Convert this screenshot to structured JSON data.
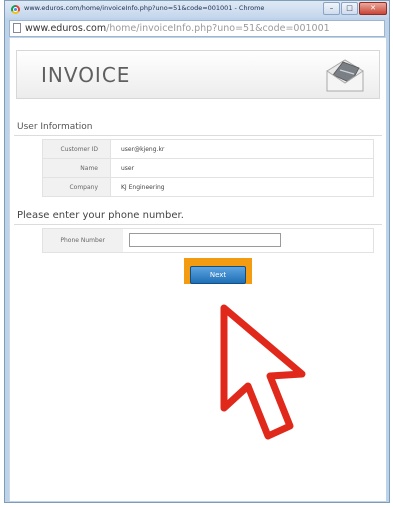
{
  "window": {
    "title": "www.eduros.com/home/invoiceInfo.php?uno=51&code=001001 - Chrome",
    "controls": [
      "–",
      "□",
      "✕"
    ]
  },
  "address_bar": {
    "host": "www.eduros.com",
    "path": "/home/invoiceInfo.php?uno=51&code=001001"
  },
  "banner": {
    "title": "INVOICE",
    "icon": "envelope-icon"
  },
  "user_info": {
    "heading": "User Information",
    "rows": [
      {
        "label": "Customer ID",
        "value": "user@kjeng.kr"
      },
      {
        "label": "Name",
        "value": "user"
      },
      {
        "label": "Company",
        "value": "KJ Engineering"
      }
    ]
  },
  "phone": {
    "heading": "Please enter your phone number.",
    "label": "Phone Number",
    "value": "",
    "placeholder": ""
  },
  "next_button": {
    "label": "Next",
    "highlight_color": "#f39c12"
  },
  "cursor": {
    "icon": "cursor-arrow-icon",
    "color": "#e0281b"
  }
}
